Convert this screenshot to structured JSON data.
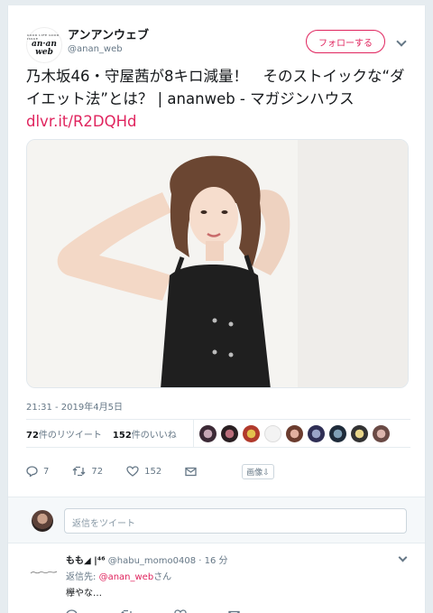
{
  "account": {
    "logo_top": "GOOD LIFE GOOD ISSUE",
    "logo_line1": "an·an",
    "logo_line2": "web",
    "display_name": "アンアンウェブ",
    "handle": "@anan_web"
  },
  "follow_button": {
    "label": "フォローする"
  },
  "tweet": {
    "text": "乃木坂46・守屋茜が8キロ減量！　そのストイックな“ダイエット法”とは？ | ananweb - マガジンハウス ",
    "link": "dlvr.it/R2DQHd",
    "timestamp": "21:31 - 2019年4月5日"
  },
  "stats": {
    "retweets_count": "72",
    "retweets_label": "件のリツイート",
    "likes_count": "152",
    "likes_label": "件のいいね"
  },
  "actions": {
    "reply_count": "7",
    "retweet_count": "72",
    "like_count": "152",
    "image_button": "画像⇩"
  },
  "reply_box": {
    "placeholder": "返信をツイート"
  },
  "reply_tweet": {
    "name": "もも◢ |⁴⁶",
    "handle": "@habu_momo0408",
    "sep": " · ",
    "time": "16 分",
    "reply_to_prefix": "返信先: ",
    "reply_to_handle": "@anan_web",
    "reply_to_suffix": "さん",
    "text": "欅やな…"
  },
  "colors": {
    "accent": "#e0245e",
    "muted": "#657786",
    "background": "#e6ecf0"
  }
}
